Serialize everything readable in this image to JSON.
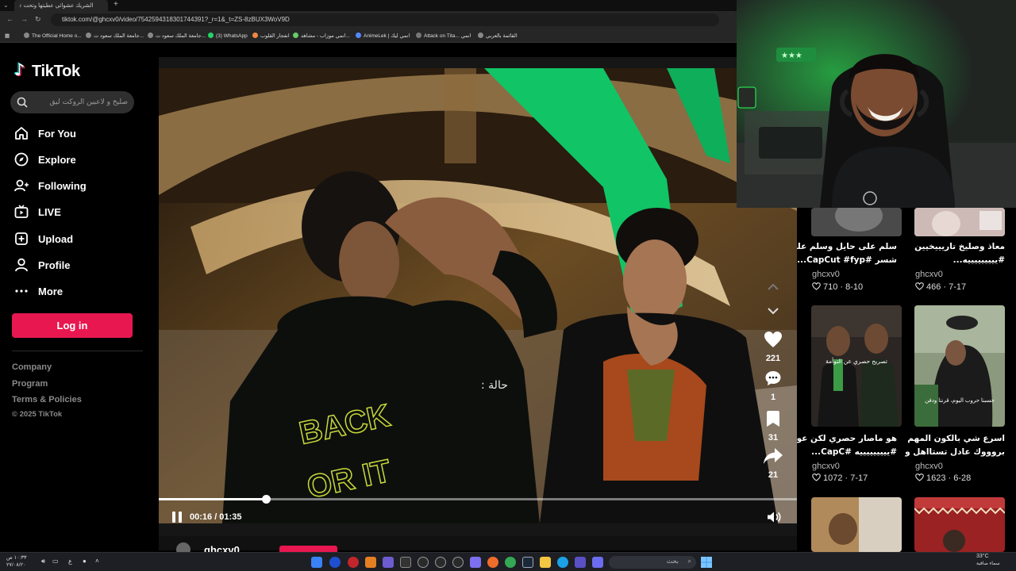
{
  "browser": {
    "tab_title": "الشريك عشوائي عطيتها وتحت",
    "new_tab": "+",
    "url": "tiktok.com/@ghcxv0/video/7542594318301744391?_r=1&_t=ZS-8zBUX3WoV9D",
    "bookmarks": [
      "The Official Home o...",
      "جامعة الملك سعود ت...",
      "جامعة الملك سعود ت...",
      "(3) WhatsApp",
      "انفجار القلوب",
      "انمي موزاب - مشاهد...",
      "AnimeLek | انمي ليك",
      "Attack on Tita... انمي",
      "القائمة بالعربي"
    ]
  },
  "sidebar": {
    "logo_text": "TikTok",
    "search_placeholder": "صليخ و لاعبين الروكت ليق",
    "nav": [
      {
        "label": "For You",
        "icon": "home-icon"
      },
      {
        "label": "Explore",
        "icon": "compass-icon"
      },
      {
        "label": "Following",
        "icon": "following-icon"
      },
      {
        "label": "LIVE",
        "icon": "live-icon"
      },
      {
        "label": "Upload",
        "icon": "upload-icon"
      },
      {
        "label": "Profile",
        "icon": "profile-icon"
      },
      {
        "label": "More",
        "icon": "more-icon"
      }
    ],
    "login_label": "Log in",
    "footer": [
      "Company",
      "Program",
      "Terms & Policies"
    ],
    "copyright": "© 2025 TikTok"
  },
  "player": {
    "caption": "حالة :",
    "time": "00:16 / 01:35",
    "progress": 0.168,
    "actions": [
      {
        "icon": "heart-icon",
        "count": "221"
      },
      {
        "icon": "comment-icon",
        "count": "1"
      },
      {
        "icon": "bookmark-icon",
        "count": "31"
      },
      {
        "icon": "share-icon",
        "count": "21"
      }
    ],
    "author": "ghcxv0"
  },
  "grid": [
    {
      "title": "سلم على حايل وسلم على",
      "title2": "شسر #CapCut #fyp...",
      "author": "ghcxv0",
      "likes": "710",
      "date": "8-10"
    },
    {
      "title": "معاذ وصليخ تاريييخيين",
      "title2": "#يييييييييه...",
      "author": "ghcxv0",
      "likes": "466",
      "date": "7-17"
    },
    {
      "title": "هو ماصار حصري لكن عوافي",
      "title2": "#يييييييييه #CapC...",
      "author": "ghcxv0",
      "likes": "1072",
      "date": "7-17"
    },
    {
      "title": "اسرع شي بالكون المهم",
      "title2": "بروووك عادل تستااهل والله",
      "author": "ghcxv0",
      "likes": "1623",
      "date": "6-28"
    }
  ],
  "thumb_captions": [
    "تصريح حصري عن التوأمة",
    "حسبنا حروب اليوم، قرننا ودفن"
  ],
  "taskbar": {
    "search_text": "بحث",
    "lang": "ع",
    "weather": "33°C",
    "weather_desc": "سماء صافية",
    "time": "١٠:٣٣ ص",
    "date": "٢٧/٠٨/٢٠"
  },
  "colors": {
    "accent": "#e8174f",
    "sidebar_bg": "#000000",
    "panel_bg": "#161616"
  }
}
